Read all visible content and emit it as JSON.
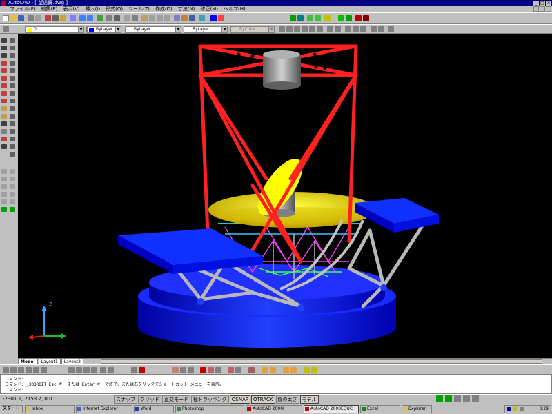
{
  "window": {
    "title": "AutoCAD - [ 望遠鏡.dwg ]",
    "minimize": "_",
    "maximize": "□",
    "close": "×"
  },
  "menu": {
    "items": [
      "ファイル(F)",
      "編集(E)",
      "表示(V)",
      "挿入(I)",
      "形式(O)",
      "ツール(T)",
      "作成(D)",
      "寸法(N)",
      "修正(M)",
      "ヘルプ(H)"
    ]
  },
  "layers": {
    "current": "0",
    "color_layer": "ByLayer",
    "linetype": "ByLayer",
    "lineweight": "ByLayer",
    "plotstyle": "ByColor",
    "color_swatch": "#0000ff"
  },
  "layout_tabs": [
    "Model",
    "Layout1",
    "Layout2"
  ],
  "command": {
    "line1": "コマンド:",
    "line2": "コマンド: _3DORBIT  Esc キーまたは Enter キーで終了、または右クリックでショートカット メニューを表示。",
    "line3": "コマンド:"
  },
  "status": {
    "coords": "-2301.1, 2153.2, 0.0",
    "modes": [
      "スナップ",
      "グリッド",
      "直交モード",
      "極トラッキング",
      "OSNAP",
      "OTRACK",
      "線の太さ",
      "モデル"
    ]
  },
  "taskbar": {
    "start": "スタート",
    "tasks": [
      "Inbox",
      "Internet Explorer",
      "Word",
      "Photoshop",
      "AutoCAD 2000i",
      "AutoCAD 2000EDUC",
      "Excel",
      "Explorer"
    ],
    "clock": "0:29"
  },
  "model": {
    "truss_color": "#ff0000",
    "mirror_color": "#ffff00",
    "base_color": "#0000ff",
    "platform_color": "#0033ff"
  }
}
